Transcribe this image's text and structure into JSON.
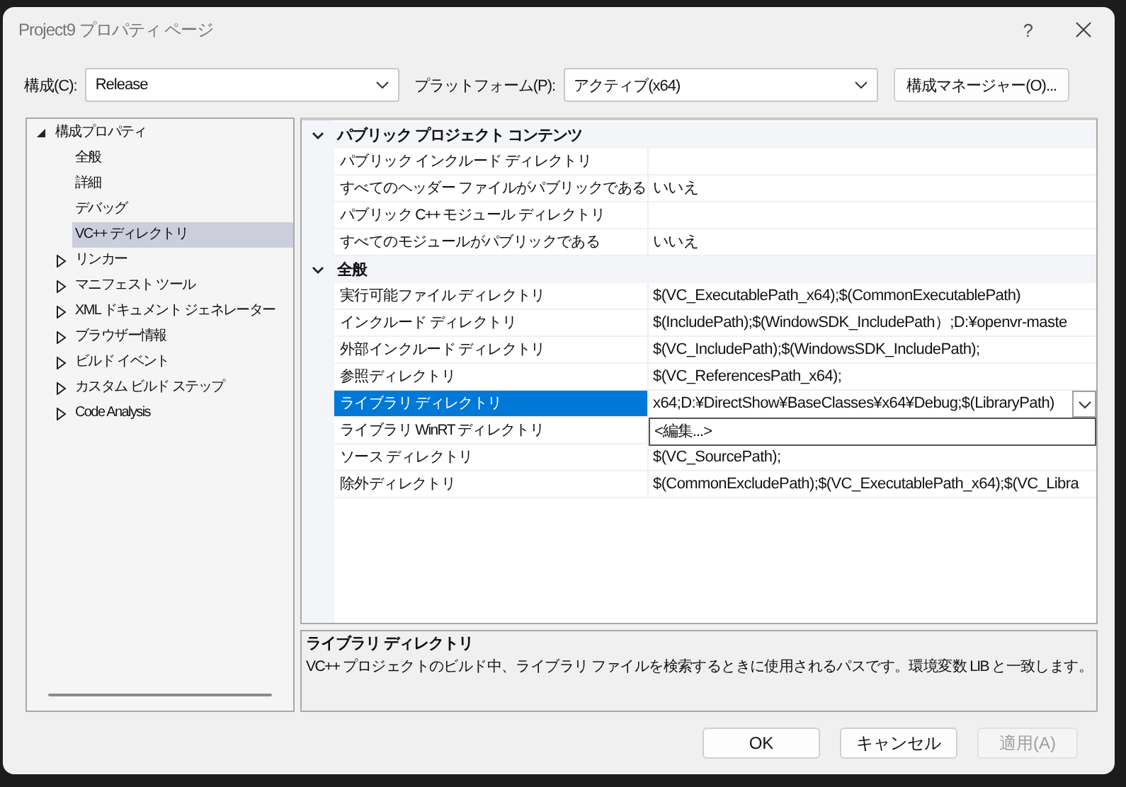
{
  "window": {
    "title": "Project9 プロパティ ページ",
    "help": "?"
  },
  "toolbar": {
    "configuration": {
      "label": "構成(C):",
      "value": "Release"
    },
    "platform": {
      "label": "プラットフォーム(P):",
      "value": "アクティブ(x64)"
    },
    "manager_button": "構成マネージャー(O)..."
  },
  "tree": [
    {
      "label": "構成プロパティ",
      "kind": "folder",
      "expanded": true,
      "selected": false,
      "children": [
        {
          "label": "全般",
          "kind": "page",
          "selected": false
        },
        {
          "label": "詳細",
          "kind": "page",
          "selected": false
        },
        {
          "label": "デバッグ",
          "kind": "page",
          "selected": false
        },
        {
          "label": "VC++ ディレクトリ",
          "kind": "page",
          "selected": true
        },
        {
          "label": "リンカー",
          "kind": "folder",
          "expanded": false,
          "selected": false
        },
        {
          "label": "マニフェスト ツール",
          "kind": "folder",
          "expanded": false,
          "selected": false
        },
        {
          "label": "XML ドキュメント ジェネレーター",
          "kind": "folder",
          "expanded": false,
          "selected": false
        },
        {
          "label": "ブラウザー情報",
          "kind": "folder",
          "expanded": false,
          "selected": false
        },
        {
          "label": "ビルド イベント",
          "kind": "folder",
          "expanded": false,
          "selected": false
        },
        {
          "label": "カスタム ビルド ステップ",
          "kind": "folder",
          "expanded": false,
          "selected": false
        },
        {
          "label": "Code Analysis",
          "kind": "folder",
          "expanded": false,
          "selected": false
        }
      ]
    }
  ],
  "grid": {
    "categories": [
      {
        "title": "パブリック プロジェクト コンテンツ",
        "expanded": true,
        "rows": [
          {
            "name": "パブリック インクルード ディレクトリ",
            "value": "",
            "selected": false
          },
          {
            "name": "すべてのヘッダー ファイルがパブリックである",
            "value": "いいえ",
            "selected": false
          },
          {
            "name": "パブリック C++ モジュール ディレクトリ",
            "value": "",
            "selected": false
          },
          {
            "name": "すべてのモジュールがパブリックである",
            "value": "いいえ",
            "selected": false
          }
        ]
      },
      {
        "title": "全般",
        "expanded": true,
        "rows": [
          {
            "name": "実行可能ファイル ディレクトリ",
            "value": "$(VC_ExecutablePath_x64);$(CommonExecutablePath)",
            "selected": false
          },
          {
            "name": "インクルード ディレクトリ",
            "value": "$(IncludePath);$(WindowSDK_IncludePath）;D:¥openvr-maste",
            "selected": false
          },
          {
            "name": "外部インクルード ディレクトリ",
            "value": "$(VC_IncludePath);$(WindowsSDK_IncludePath);",
            "selected": false
          },
          {
            "name": "参照ディレクトリ",
            "value": "$(VC_ReferencesPath_x64);",
            "selected": false
          },
          {
            "name": "ライブラリ ディレクトリ",
            "value": "x64;D:¥DirectShow¥BaseClasses¥x64¥Debug;$(LibraryPath)",
            "selected": true,
            "dropdown": [
              "<編集...>"
            ]
          },
          {
            "name": "ライブラリ WinRT ディレクトリ",
            "value": "",
            "selected": false
          },
          {
            "name": "ソース ディレクトリ",
            "value": "$(VC_SourcePath);",
            "selected": false
          },
          {
            "name": "除外ディレクトリ",
            "value": "$(CommonExcludePath);$(VC_ExecutablePath_x64);$(VC_Libra",
            "selected": false
          }
        ]
      }
    ]
  },
  "description": {
    "title": "ライブラリ ディレクトリ",
    "text": "VC++ プロジェクトのビルド中、ライブラリ ファイルを検索するときに使用されるパスです。環境変数 LIB と一致します。"
  },
  "buttons": [
    {
      "label": "OK",
      "disabled": false
    },
    {
      "label": "キャンセル",
      "disabled": false
    },
    {
      "label": "適用(A)",
      "disabled": true
    }
  ]
}
